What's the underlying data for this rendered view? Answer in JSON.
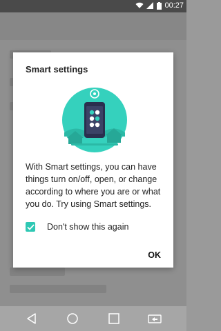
{
  "status_bar": {
    "time": "00:27",
    "icons": [
      "wifi-icon",
      "signal-icon",
      "battery-icon"
    ]
  },
  "dialog": {
    "title": "Smart settings",
    "illustration": "smart-settings-phone-illustration",
    "body": "With Smart settings, you can have things turn on/off, open, or change according to where you are or what you do. Try using Smart settings.",
    "checkbox": {
      "label": "Don't show this again",
      "checked": true
    },
    "ok_label": "OK"
  },
  "nav_bar": {
    "icons": [
      "back-icon",
      "home-icon",
      "recents-icon",
      "switch-sim-icon"
    ]
  },
  "colors": {
    "accent": "#2fc8b4",
    "illustration_circle": "#35d1bd",
    "phone_body": "#2a2f4e"
  }
}
